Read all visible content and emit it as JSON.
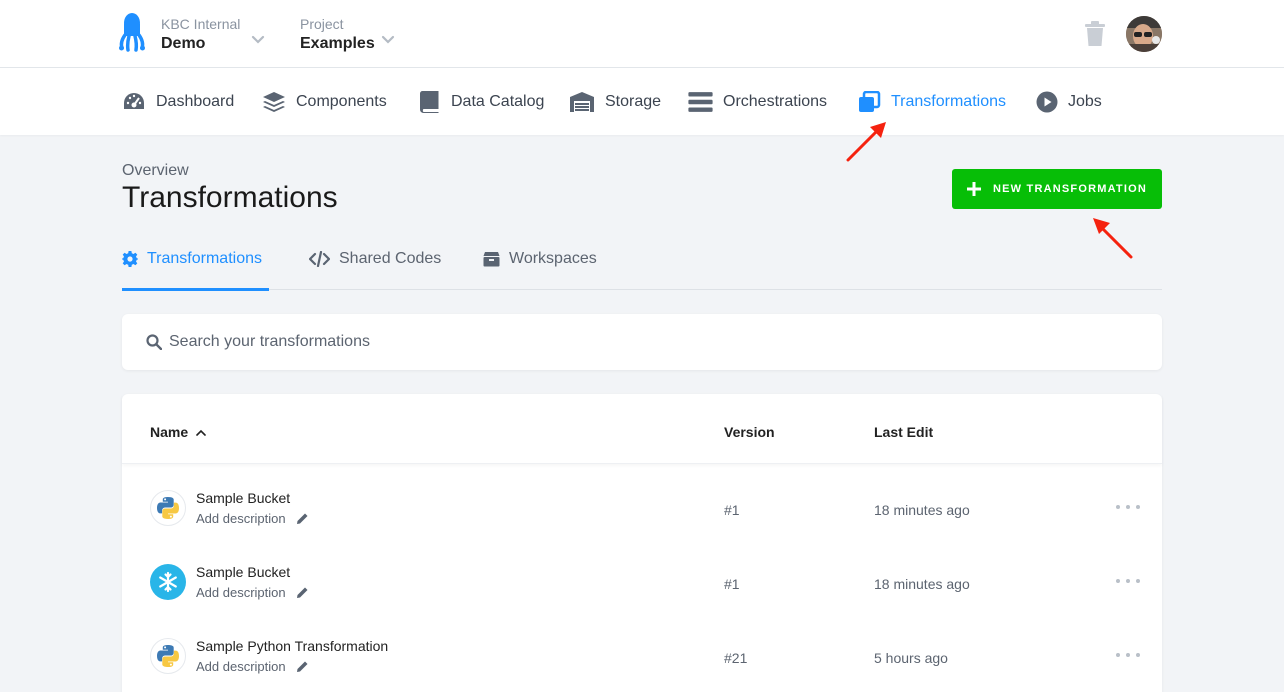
{
  "header": {
    "org_label": "KBC Internal",
    "org_value": "Demo",
    "project_label": "Project",
    "project_value": "Examples"
  },
  "nav": {
    "items": [
      {
        "label": "Dashboard",
        "icon": "dashboard-icon"
      },
      {
        "label": "Components",
        "icon": "layers-icon"
      },
      {
        "label": "Data Catalog",
        "icon": "book-icon"
      },
      {
        "label": "Storage",
        "icon": "warehouse-icon"
      },
      {
        "label": "Orchestrations",
        "icon": "bars-icon"
      },
      {
        "label": "Transformations",
        "icon": "window-restore-icon",
        "active": true
      },
      {
        "label": "Jobs",
        "icon": "play-circle-icon"
      }
    ]
  },
  "page": {
    "overview_label": "Overview",
    "title": "Transformations",
    "new_button_label": "NEW TRANSFORMATION"
  },
  "tabs": [
    {
      "label": "Transformations",
      "icon": "gear-icon",
      "active": true
    },
    {
      "label": "Shared Codes",
      "icon": "code-icon"
    },
    {
      "label": "Workspaces",
      "icon": "box-icon"
    }
  ],
  "search": {
    "placeholder": "Search your transformations",
    "value": ""
  },
  "table": {
    "columns": [
      "Name",
      "Version",
      "Last Edit"
    ],
    "rows": [
      {
        "name": "Sample Bucket",
        "description": "Add description",
        "version": "#1",
        "last_edit": "18 minutes ago",
        "icon": "python-icon"
      },
      {
        "name": "Sample Bucket",
        "description": "Add description",
        "version": "#1",
        "last_edit": "18 minutes ago",
        "icon": "snowflake-icon"
      },
      {
        "name": "Sample Python Transformation",
        "description": "Add description",
        "version": "#21",
        "last_edit": "5 hours ago",
        "icon": "python-icon"
      }
    ]
  },
  "colors": {
    "accent": "#1f8fff",
    "primary_button": "#07be07",
    "annotation_arrow": "#f5220f"
  }
}
